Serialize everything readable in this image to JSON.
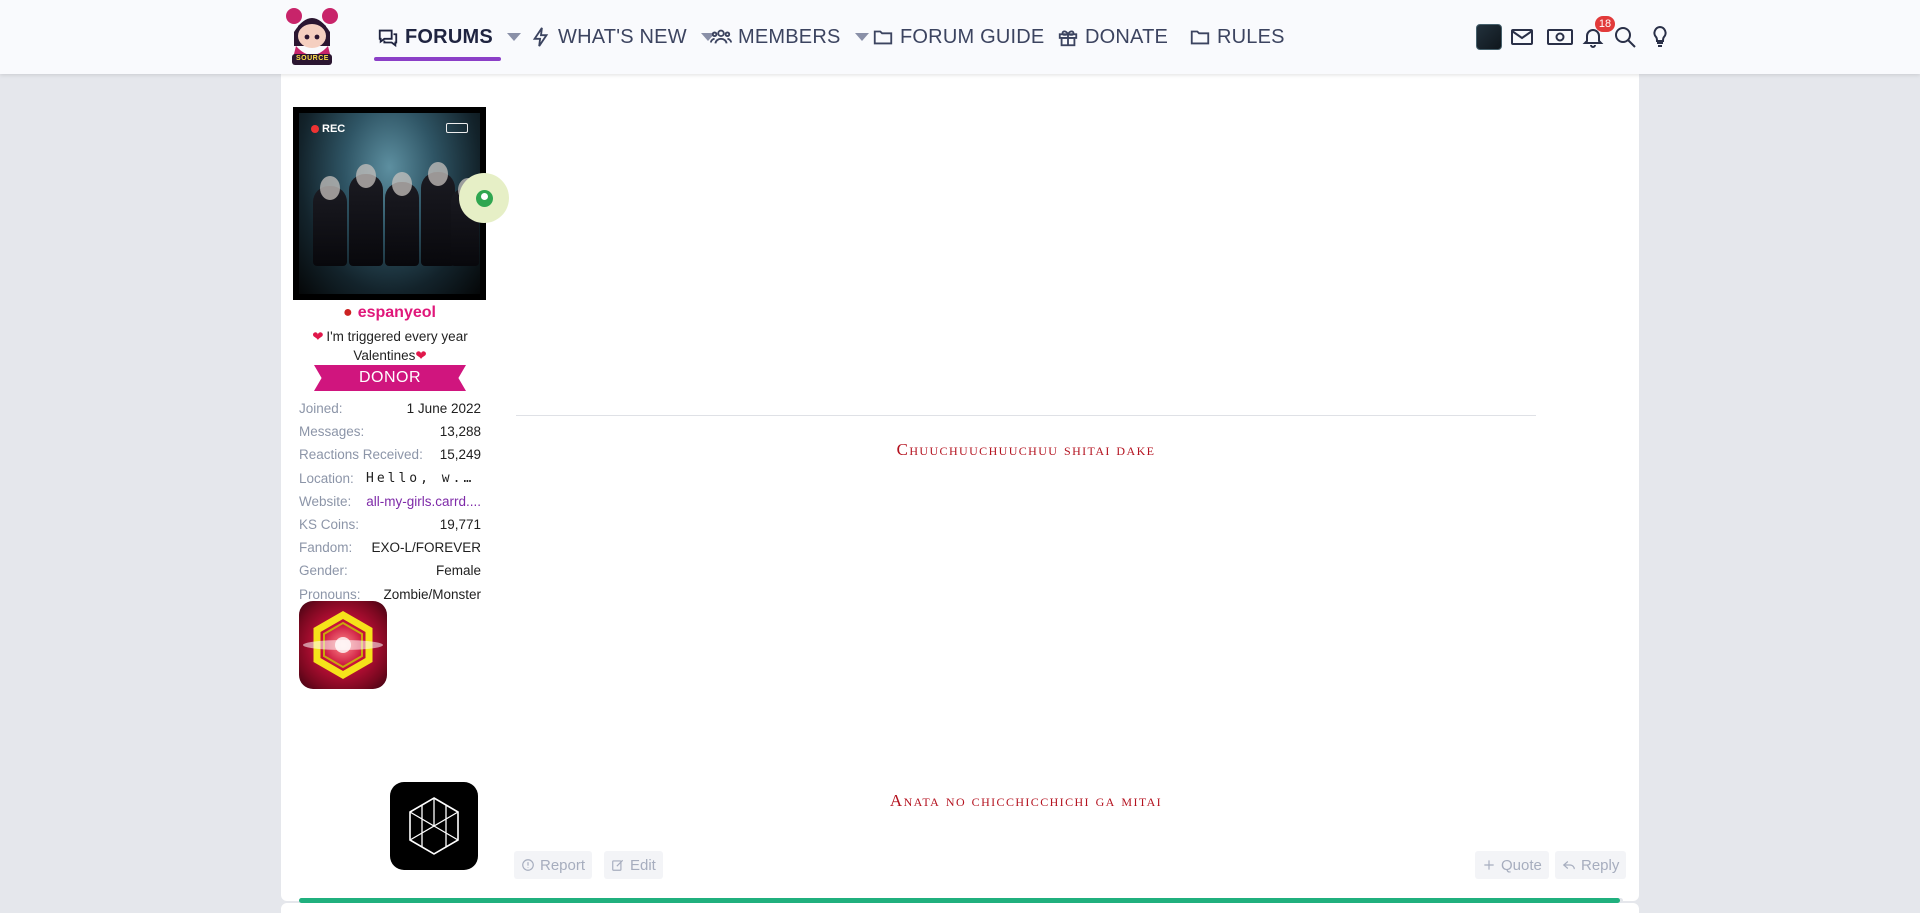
{
  "nav": {
    "logo_text": "SOURCE",
    "items": [
      {
        "label": "FORUMS",
        "active": true,
        "dropdown": true,
        "icon": "comments-icon"
      },
      {
        "label": "WHAT'S NEW",
        "active": false,
        "dropdown": true,
        "icon": "bolt-icon"
      },
      {
        "label": "MEMBERS",
        "active": false,
        "dropdown": true,
        "icon": "users-icon"
      },
      {
        "label": "FORUM GUIDE",
        "active": false,
        "dropdown": false,
        "icon": "folder-icon"
      },
      {
        "label": "DONATE",
        "active": false,
        "dropdown": false,
        "icon": "gift-icon"
      },
      {
        "label": "RULES",
        "active": false,
        "dropdown": false,
        "icon": "folder-icon"
      }
    ],
    "alerts_count": "18",
    "accent_color": "#8b3fc7"
  },
  "user": {
    "avatar_rec_label": "REC",
    "username": "espanyeol",
    "username_color": "#e0177a",
    "title_line1": "I'm triggered every year",
    "title_line2": "Valentines",
    "banner": "DONOR",
    "banner_color": "#d0157e",
    "online": true,
    "info": [
      {
        "label": "Joined:",
        "value": "1 June 2022"
      },
      {
        "label": "Messages:",
        "value": "13,288"
      },
      {
        "label": "Reactions Received:",
        "value": "15,249"
      },
      {
        "label": "Location:",
        "value": "Hello, w..."
      },
      {
        "label": "Website:",
        "value": "all-my-girls.carrd...."
      },
      {
        "label": "KS Coins:",
        "value": "19,771"
      },
      {
        "label": "Fandom:",
        "value": "EXO-L/FOREVER"
      },
      {
        "label": "Gender:",
        "value": "Female"
      },
      {
        "label": "Pronouns:",
        "value": "Zombie/Monster"
      }
    ]
  },
  "post": {
    "lyric_1": "Chuuchuuchuuchuu shitai dake",
    "lyric_2": "Anata no chicchicchichi ga mitai",
    "lyric_color": "#b4121f"
  },
  "actions": {
    "report": "Report",
    "edit": "Edit",
    "quote": "Quote",
    "reply": "Reply"
  },
  "progress": {
    "fraction": 0.998,
    "color": "#20b07e"
  }
}
